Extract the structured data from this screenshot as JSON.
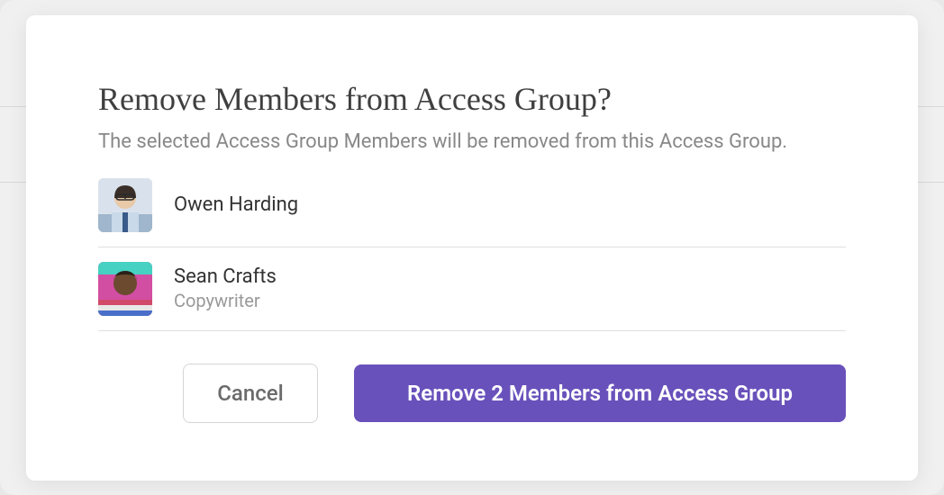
{
  "modal": {
    "title": "Remove Members from Access Group?",
    "subtitle": "The selected Access Group Members will be removed from this Access Group.",
    "members": [
      {
        "name": "Owen Harding",
        "role": ""
      },
      {
        "name": "Sean Crafts",
        "role": "Copywriter"
      }
    ],
    "actions": {
      "cancel_label": "Cancel",
      "confirm_label": "Remove 2 Members from Access Group"
    }
  },
  "colors": {
    "primary": "#6951bb"
  }
}
